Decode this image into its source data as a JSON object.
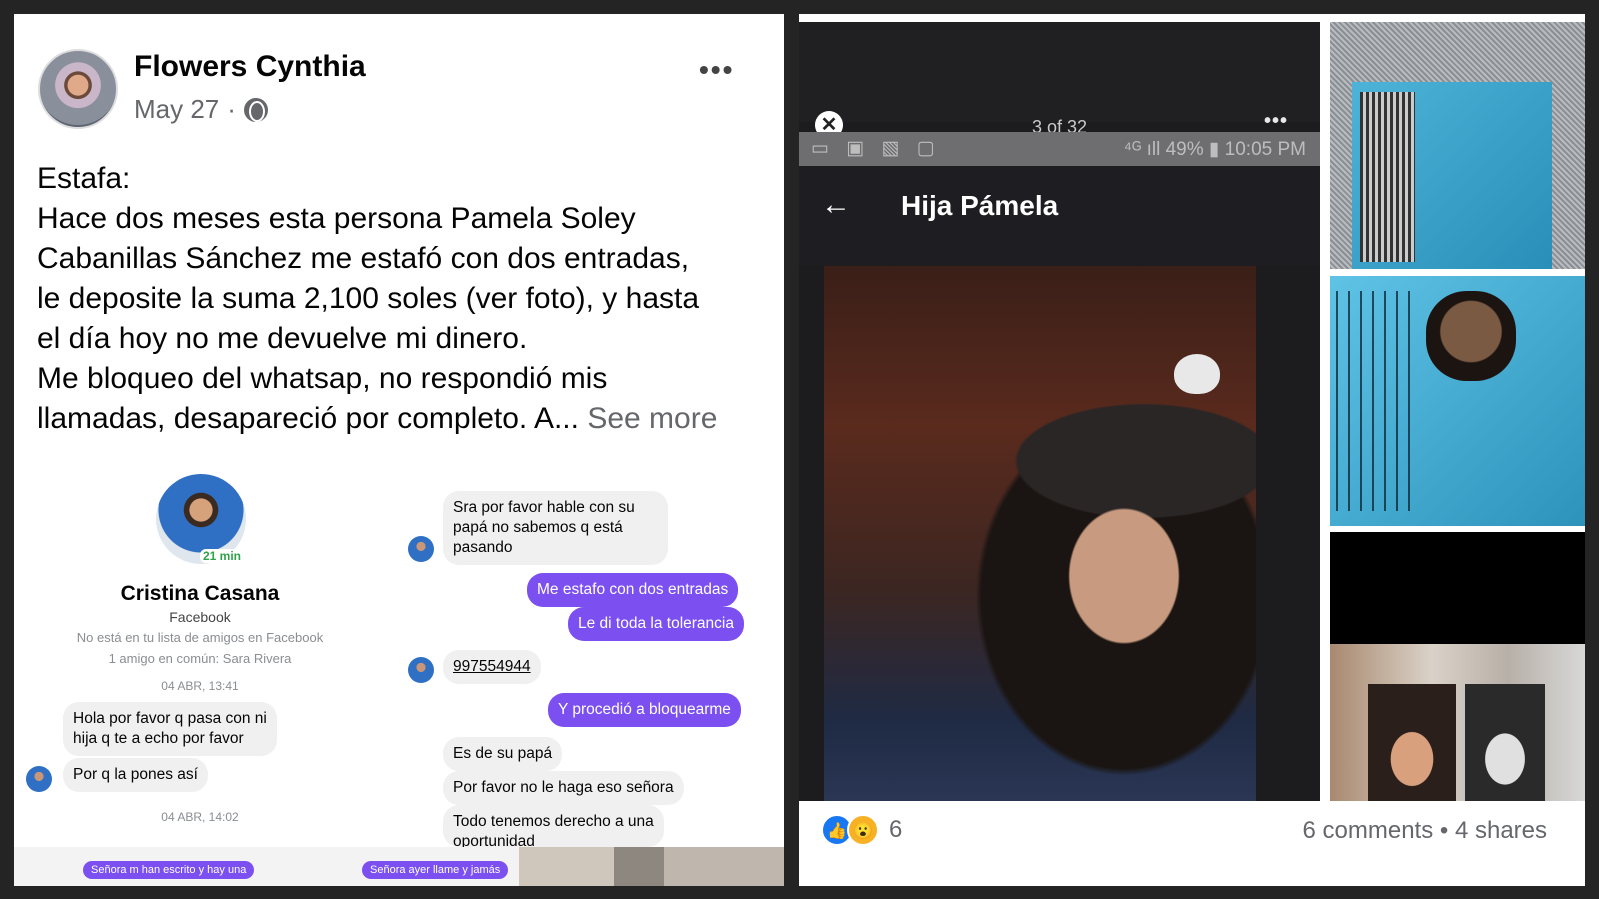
{
  "post": {
    "author": "Flowers Cynthia",
    "date": "May 27",
    "separator": "·",
    "more_label": "•••",
    "text": "Estafa:\nHace dos meses esta persona Pamela Soley\nCabanillas Sánchez me estafó con dos entradas,\nle deposite la suma 2,100 soles (ver foto), y hasta\nel día hoy no me devuelve mi dinero.\nMe bloqueo del whatsap, no respondió mis\nllamadas, desapareció por completo. A...",
    "see_more": "See more"
  },
  "chat": {
    "status": "21 min",
    "name": "Cristina Casana",
    "platform": "Facebook",
    "not_friend": "No está en tu lista de amigos en Facebook",
    "mutual": "1 amigo en común: Sara Rivera",
    "date1": "04 ABR, 13:41",
    "date2": "04 ABR, 14:02",
    "messages_left": [
      "Hola por favor q pasa con ni\nhija q te a echo por favor",
      "Por q la pones así"
    ],
    "messages_right": [
      "Sra por favor hable con su\npapá no sabemos q está\npasando",
      "Me estafo con dos entradas",
      "Le di toda la tolerancia",
      "997554944",
      "Y procedió a bloquearme",
      "Es de su papá",
      "Por favor no le haga eso señora",
      "Todo tenemos derecho a una\noportunidad"
    ],
    "strip": [
      "Señora m han escrito y hay una",
      "Señora ayer llame y jamás"
    ]
  },
  "viewer": {
    "close": "✕",
    "counter": "3 of 32",
    "more": "•••",
    "status_left": "▭ ▣ ▧ ▢",
    "status_right": "⁴ᴳ ıll 49% ▮ 10:05 PM",
    "back": "←",
    "contact": "Hija Pámela"
  },
  "footer": {
    "like_icon": "👍",
    "wow_icon": "😮",
    "reaction_count": "6",
    "engagement": "6 comments • 4 shares"
  }
}
